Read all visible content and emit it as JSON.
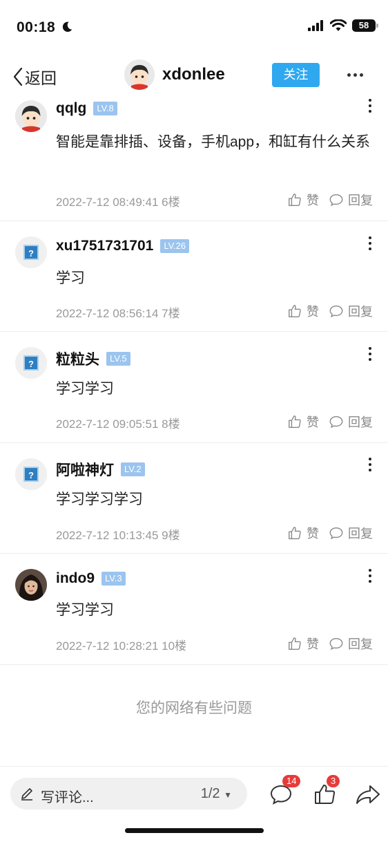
{
  "status_bar": {
    "time": "00:18",
    "battery": "58"
  },
  "nav": {
    "back_label": "返回",
    "username": "xdonlee",
    "follow_label": "关注"
  },
  "comments": [
    {
      "username": "qqlg",
      "level": "LV.8",
      "text": "智能是靠排插、设备，手机app，和缸有什么关系",
      "timestamp": "2022-7-12 08:49:41",
      "floor": "6楼",
      "like_label": "赞",
      "reply_label": "回复"
    },
    {
      "username": "xu1751731701",
      "level": "LV.26",
      "text": "学习",
      "timestamp": "2022-7-12 08:56:14",
      "floor": "7楼",
      "like_label": "赞",
      "reply_label": "回复"
    },
    {
      "username": "粒粒头",
      "level": "LV.5",
      "text": "学习学习",
      "timestamp": "2022-7-12 09:05:51",
      "floor": "8楼",
      "like_label": "赞",
      "reply_label": "回复"
    },
    {
      "username": "阿啦神灯",
      "level": "LV.2",
      "text": "学习学习学习",
      "timestamp": "2022-7-12 10:13:45",
      "floor": "9楼",
      "like_label": "赞",
      "reply_label": "回复"
    },
    {
      "username": "indo9",
      "level": "LV.3",
      "text": "学习学习",
      "timestamp": "2022-7-12 10:28:21",
      "floor": "10楼",
      "like_label": "赞",
      "reply_label": "回复"
    }
  ],
  "network_message": "您的网络有些问题",
  "bottom_bar": {
    "write_placeholder": "写评论...",
    "page_indicator": "1/2",
    "comment_count": "14",
    "like_count": "3"
  },
  "colors": {
    "accent": "#2fa8f0",
    "level_badge": "#9bc4ee",
    "notification_badge": "#e63b3b"
  }
}
